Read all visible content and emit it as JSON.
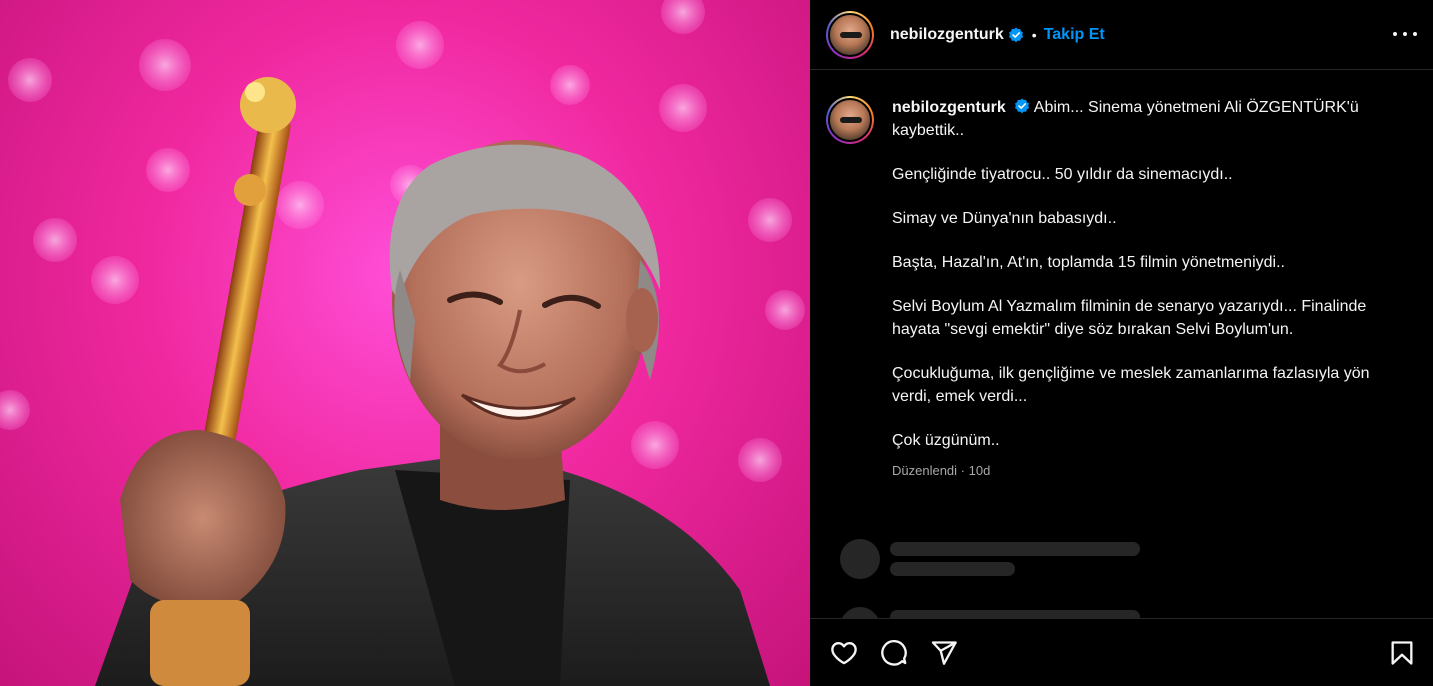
{
  "post": {
    "username": "nebilozgenturk",
    "verified": true,
    "separator": "•",
    "follow_label": "Takip Et",
    "more_icon": "more-options-icon"
  },
  "caption": {
    "username": "nebilozgenturk",
    "first_line": "Abim... Sinema yönetmeni Ali ÖZGENTÜRK'ü kaybettik..",
    "paragraphs": [
      "Gençliğinde tiyatrocu.. 50 yıldır da sinemacıydı..",
      "Simay ve Dünya'nın babasıydı..",
      "Başta, Hazal'ın, At'ın, toplamda 15 filmin yönetmeniydi..",
      "Selvi Boylum Al Yazmalım filminin de senaryo yazarıydı... Finalinde hayata \"sevgi emektir\" diye söz bırakan Selvi Boylum'un.",
      "Çocukluğuma, ilk gençliğime ve meslek zamanlarıma fazlasıyla yön verdi, emek verdi...",
      "Çok üzgünüm.."
    ],
    "edited_label": "Düzenlendi",
    "dot": "·",
    "age": "10d"
  },
  "actions": {
    "like_icon": "heart-icon",
    "comment_icon": "comment-icon",
    "share_icon": "send-icon",
    "save_icon": "bookmark-icon"
  },
  "colors": {
    "background": "#000000",
    "text": "#f5f5f5",
    "secondary_text": "#a8a8a8",
    "link_blue": "#0095f6",
    "divider": "#262626",
    "photo_bg": "#f0289f"
  }
}
